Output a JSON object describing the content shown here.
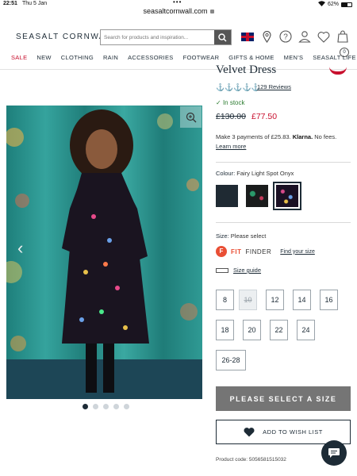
{
  "status_bar": {
    "time": "22:51",
    "date": "Thu 5 Jan",
    "battery": "62%",
    "battery_level": 0.62
  },
  "browser": {
    "url": "seasaltcornwall.com"
  },
  "header": {
    "logo": "SEASALT CORNWALL",
    "search_placeholder": "Search for products and inspiration...",
    "basket_count": "0",
    "nav": [
      "SALE",
      "NEW",
      "CLOTHING",
      "RAIN",
      "ACCESSORIES",
      "FOOTWEAR",
      "GIFTS & HOME",
      "MEN'S",
      "SEASALT LIFE"
    ]
  },
  "product": {
    "title": "Velvet Dress",
    "reviews": "129 Reviews",
    "rating_icons": "⚓⚓⚓⚓⚓",
    "stock": "In stock",
    "old_price": "£130.00",
    "new_price": "£77.50",
    "klarna_pre": "Make 3 payments of £25.83.",
    "klarna_brand": "Klarna.",
    "klarna_mid": "No fees.",
    "klarna_link": "Learn more",
    "colour_label": "Colour:",
    "colour_value": "Fairy Light Spot Onyx",
    "size_label": "Size:",
    "size_value": "Please select",
    "fit_finder_1": "FIT",
    "fit_finder_2": "FINDER",
    "fit_link": "Find your size",
    "size_guide": "Size guide",
    "sizes": [
      "8",
      "10",
      "12",
      "14",
      "16",
      "18",
      "20",
      "22",
      "24",
      "26-28"
    ],
    "select_button": "PLEASE SELECT A SIZE",
    "wishlist_button": "ADD TO WISH LIST",
    "product_code": "Product code: 5056581515032"
  },
  "gallery": {
    "image_count": 5,
    "active_index": 0
  },
  "colors": {
    "brand": "#1d2b36",
    "sale": "#c8102e",
    "stock": "#2e7d32"
  }
}
